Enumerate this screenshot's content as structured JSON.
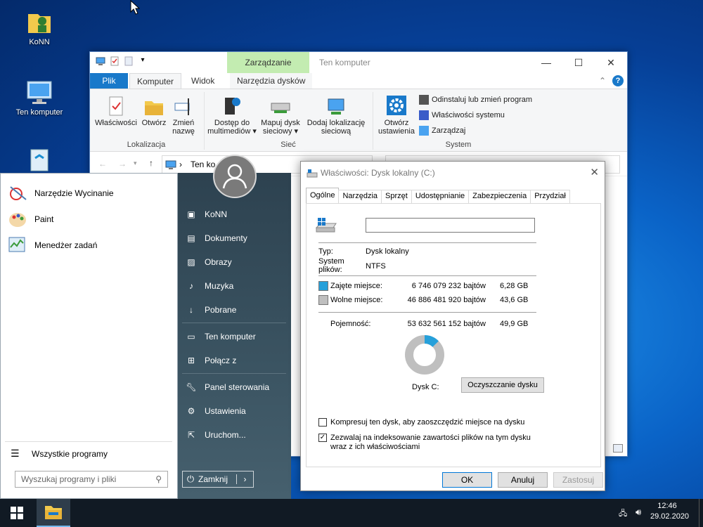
{
  "desktop": {
    "icons": [
      {
        "label": "KoNN"
      },
      {
        "label": "Ten komputer"
      }
    ]
  },
  "explorer": {
    "context_tab": "Zarządzanie",
    "window_title": "Ten komputer",
    "tabs": [
      "Plik",
      "Komputer",
      "Widok",
      "Narzędzia dysków"
    ],
    "ribbon": {
      "buttons": [
        {
          "label": "Właściwości"
        },
        {
          "label": "Otwórz"
        },
        {
          "label": "Zmień\nnazwę"
        },
        {
          "label": "Dostęp do\nmultimediów ▾"
        },
        {
          "label": "Mapuj dysk\nsieciowy ▾"
        },
        {
          "label": "Dodaj lokalizację\nsieciową"
        },
        {
          "label": "Otwórz\nustawienia"
        }
      ],
      "small": [
        "Odinstaluj lub zmień program",
        "Właściwości systemu",
        "Zarządzaj"
      ],
      "groups": [
        "Lokalizacja",
        "Sieć",
        "System"
      ]
    },
    "address": "Ten ko"
  },
  "start_menu": {
    "pinned": [
      "Narzędzie Wycinanie",
      "Paint",
      "Menedżer zadań"
    ],
    "all_programs": "Wszystkie programy",
    "search_placeholder": "Wyszukaj programy i pliki",
    "right": [
      "KoNN",
      "Dokumenty",
      "Obrazy",
      "Muzyka",
      "Pobrane",
      "Ten komputer",
      "Połącz z",
      "Panel sterowania",
      "Ustawienia",
      "Uruchom..."
    ],
    "shutdown": "Zamknij"
  },
  "properties": {
    "title": "Właściwości: Dysk lokalny (C:)",
    "tabs": [
      "Ogólne",
      "Narzędzia",
      "Sprzęt",
      "Udostępnianie",
      "Zabezpieczenia",
      "Przydział"
    ],
    "type_label": "Typ:",
    "type_value": "Dysk lokalny",
    "fs_label": "System\nplików:",
    "fs_value": "NTFS",
    "used_label": "Zajęte miejsce:",
    "used_bytes": "6 746 079 232 bajtów",
    "used_gb": "6,28 GB",
    "free_label": "Wolne miejsce:",
    "free_bytes": "46 886 481 920 bajtów",
    "free_gb": "43,6 GB",
    "cap_label": "Pojemność:",
    "cap_bytes": "53 632 561 152 bajtów",
    "cap_gb": "49,9 GB",
    "used_fraction": 0.1258,
    "disk_label": "Dysk C:",
    "cleanup": "Oczyszczanie dysku",
    "compress": "Kompresuj ten dysk, aby zaoszczędzić miejsce na dysku",
    "index": "Zezwalaj na indeksowanie zawartości plików na tym dysku\nwraz z ich właściwościami",
    "index_checked": true,
    "compress_checked": false,
    "ok": "OK",
    "cancel": "Anuluj",
    "apply": "Zastosuj",
    "colors": {
      "used": "#26a0da",
      "free": "#bfbfbf"
    }
  },
  "taskbar": {
    "time": "12:46",
    "date": "29.02.2020"
  }
}
